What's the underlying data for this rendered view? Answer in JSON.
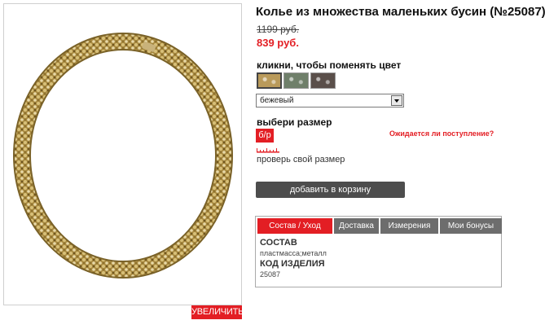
{
  "product": {
    "title": "Колье из множества маленьких бусин (№25087)",
    "old_price": "1199 руб.",
    "new_price": "839 руб."
  },
  "image": {
    "zoom_label": "УВЕЛИЧИТЬ"
  },
  "color": {
    "label": "кликни, чтобы поменять цвет",
    "swatches": [
      {
        "name": "beige",
        "hex": "#b99a5a"
      },
      {
        "name": "green",
        "hex": "#6f7f6a"
      },
      {
        "name": "dark",
        "hex": "#5a4f4a"
      }
    ],
    "selected": "бежевый"
  },
  "size": {
    "label": "выбери размер",
    "option": "б/р",
    "expect_link": "Ожидается ли поступление?",
    "check_link": "проверь свой размер"
  },
  "cart": {
    "button_label": "добавить в корзину"
  },
  "tabs": {
    "items": [
      "Состав / Уход",
      "Доставка",
      "Измерения",
      "Мои бонусы"
    ],
    "content": {
      "composition_title": "СОСТАВ",
      "composition_value": "пластмасса;металл",
      "code_title": "КОД ИЗДЕЛИЯ",
      "code_value": "25087"
    }
  },
  "colors": {
    "accent": "#e31e24",
    "tab_inactive": "#6d6d6d",
    "button_dark": "#4d4d4d"
  }
}
